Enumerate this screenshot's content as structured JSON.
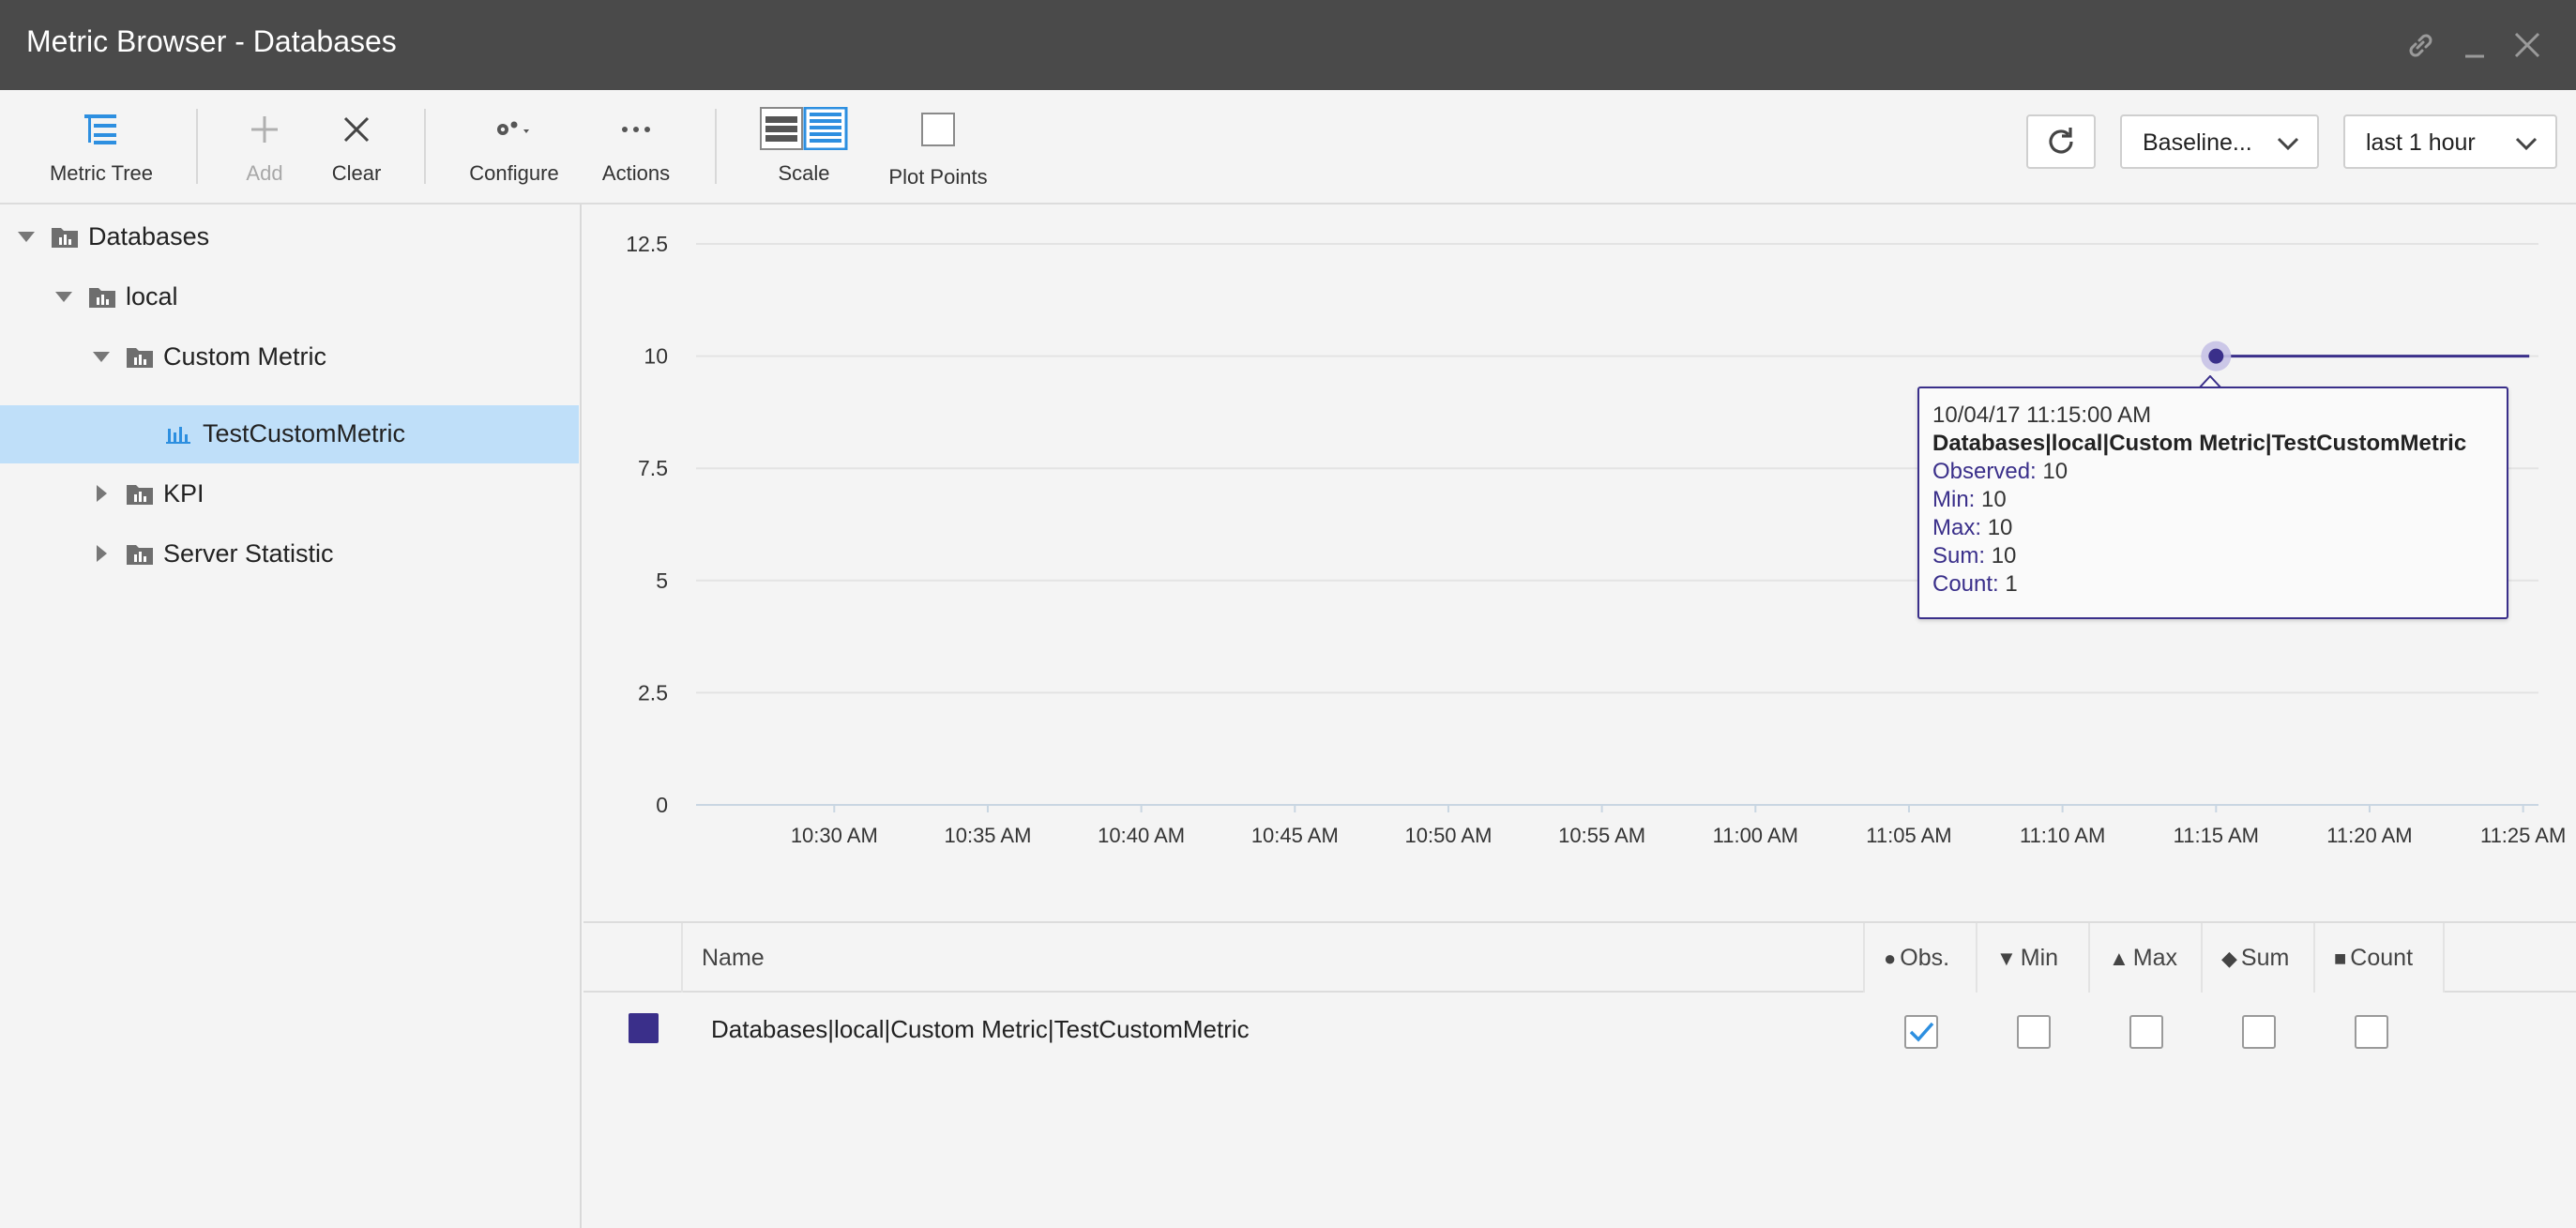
{
  "window": {
    "title": "Metric Browser - Databases",
    "controls": [
      "link-icon",
      "minimize-icon",
      "close-icon"
    ]
  },
  "toolbar": {
    "metric_tree": "Metric Tree",
    "add": "Add",
    "clear": "Clear",
    "configure": "Configure",
    "actions": "Actions",
    "scale": "Scale",
    "plot_points": "Plot Points",
    "baseline_select": "Baseline...",
    "time_range_select": "last 1 hour"
  },
  "tree": {
    "items": [
      {
        "label": "Databases",
        "expanded": true,
        "level": 0
      },
      {
        "label": "local",
        "expanded": true,
        "level": 1
      },
      {
        "label": "Custom Metric",
        "expanded": true,
        "level": 2
      },
      {
        "label": "TestCustomMetric",
        "selected": true,
        "level": 3
      },
      {
        "label": "KPI",
        "expanded": false,
        "level": 2
      },
      {
        "label": "Server Statistic",
        "expanded": false,
        "level": 2
      }
    ]
  },
  "chart_data": {
    "type": "line",
    "y_ticks": [
      "12.5",
      "10",
      "7.5",
      "5",
      "2.5",
      "0"
    ],
    "ylim": [
      0,
      12.5
    ],
    "x_ticks": [
      "10:30 AM",
      "10:35 AM",
      "10:40 AM",
      "10:45 AM",
      "10:50 AM",
      "10:55 AM",
      "11:00 AM",
      "11:05 AM",
      "11:10 AM",
      "11:15 AM",
      "11:20 AM",
      "11:25 AM"
    ],
    "x_tick_minutes": [
      630,
      635,
      640,
      645,
      650,
      655,
      660,
      665,
      670,
      675,
      680,
      685
    ],
    "xlim_minutes": [
      625.5,
      685.5
    ],
    "series": [
      {
        "name": "Databases|local|Custom Metric|TestCustomMetric",
        "color": "#3a2f8a",
        "points": [
          {
            "t_minutes": 675,
            "y": 10
          },
          {
            "t_minutes": 685.2,
            "y": 10
          }
        ]
      }
    ],
    "highlight_minutes": 675,
    "grid": true
  },
  "tooltip": {
    "timestamp": "10/04/17 11:15:00 AM",
    "path": "Databases|local|Custom Metric|TestCustomMetric",
    "observed_label": "Observed:",
    "observed": "10",
    "min_label": "Min:",
    "min": "10",
    "max_label": "Max:",
    "max": "10",
    "sum_label": "Sum:",
    "sum": "10",
    "count_label": "Count:",
    "count": "1"
  },
  "table": {
    "headers": {
      "name": "Name",
      "obs": "Obs.",
      "min": "Min",
      "max": "Max",
      "sum": "Sum",
      "count": "Count"
    },
    "rows": [
      {
        "color": "#3a2f8a",
        "name": "Databases|local|Custom Metric|TestCustomMetric",
        "obs": true,
        "min": false,
        "max": false,
        "sum": false,
        "count": false
      }
    ]
  }
}
